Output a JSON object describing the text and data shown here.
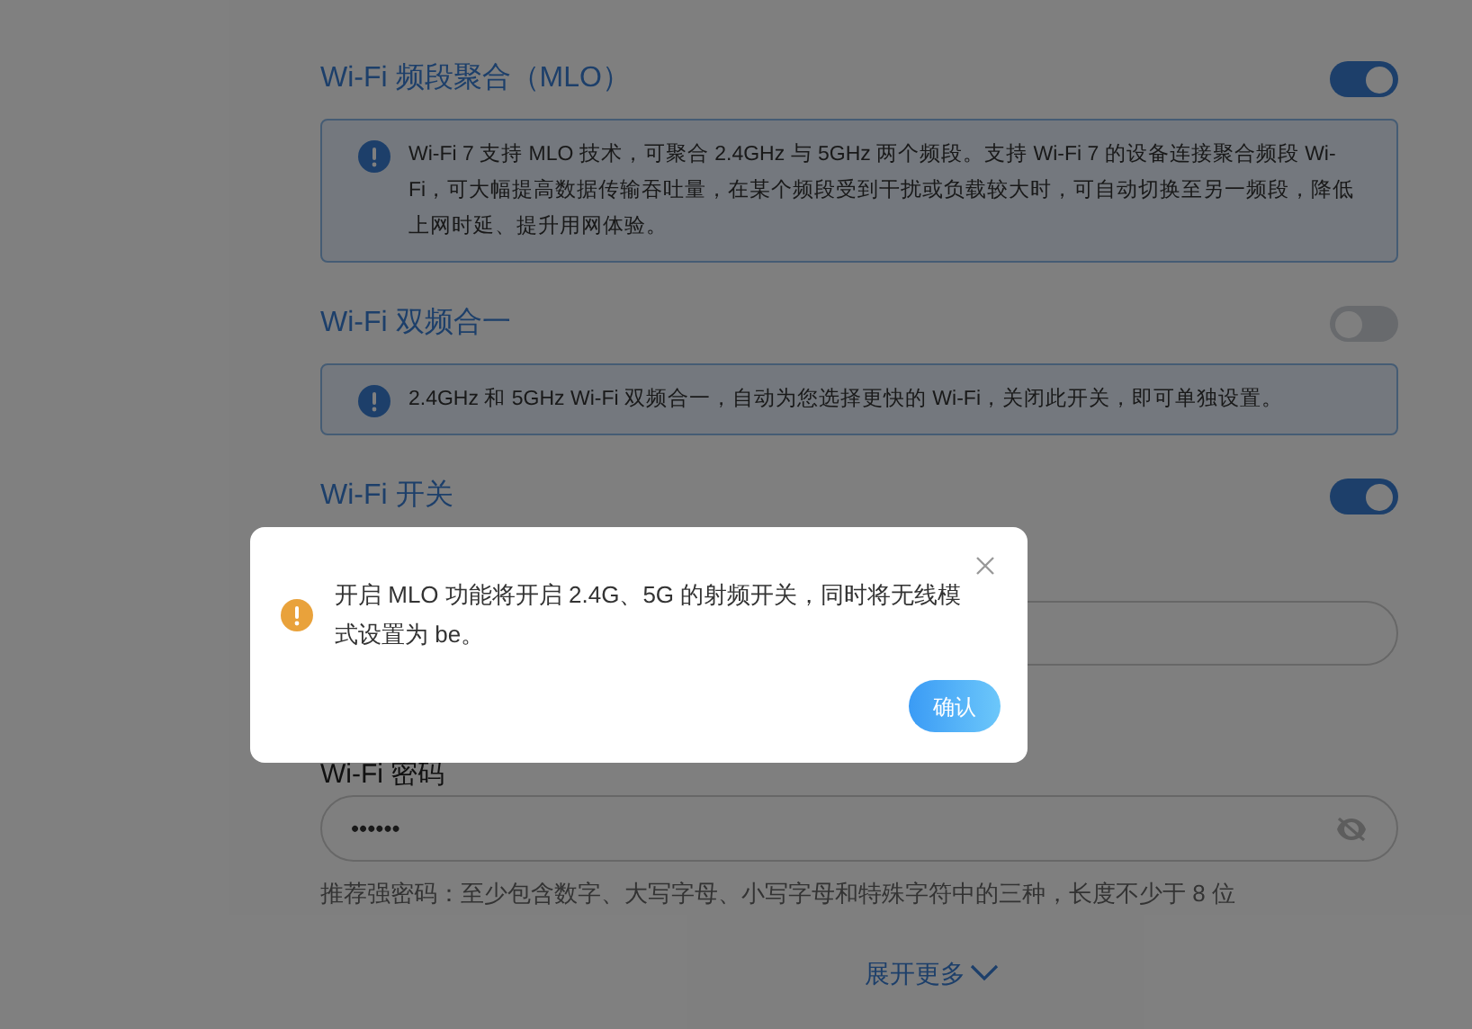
{
  "settings": [
    {
      "kind": "toggle",
      "label": "Wi-Fi 频段聚合（MLO）",
      "on": true,
      "info": "Wi-Fi 7 支持 MLO 技术，可聚合 2.4GHz 与 5GHz 两个频段。支持 Wi-Fi 7 的设备连接聚合频段 Wi-Fi，可大幅提高数据传输吞吐量，在某个频段受到干扰或负载较大时，可自动切换至另一频段，降低上网时延、提升用网体验。"
    },
    {
      "kind": "toggle",
      "label": "Wi-Fi 双频合一",
      "on": false,
      "info": "2.4GHz 和 5GHz Wi-Fi 双频合一，自动为您选择更快的 Wi-Fi，关闭此开关，即可单独设置。"
    },
    {
      "kind": "toggle",
      "label": "Wi-Fi 开关",
      "on": true
    }
  ],
  "password": {
    "label": "Wi-Fi 密码",
    "value": "••••••",
    "hint": "推荐强密码：至少包含数字、大写字母、小写字母和特殊字符中的三种，长度不少于 8 位"
  },
  "expand_link": "展开更多",
  "dialog": {
    "message": "开启 MLO 功能将开启 2.4G、5G 的射频开关，同时将无线模式设置为 be。",
    "confirm": "确认"
  }
}
